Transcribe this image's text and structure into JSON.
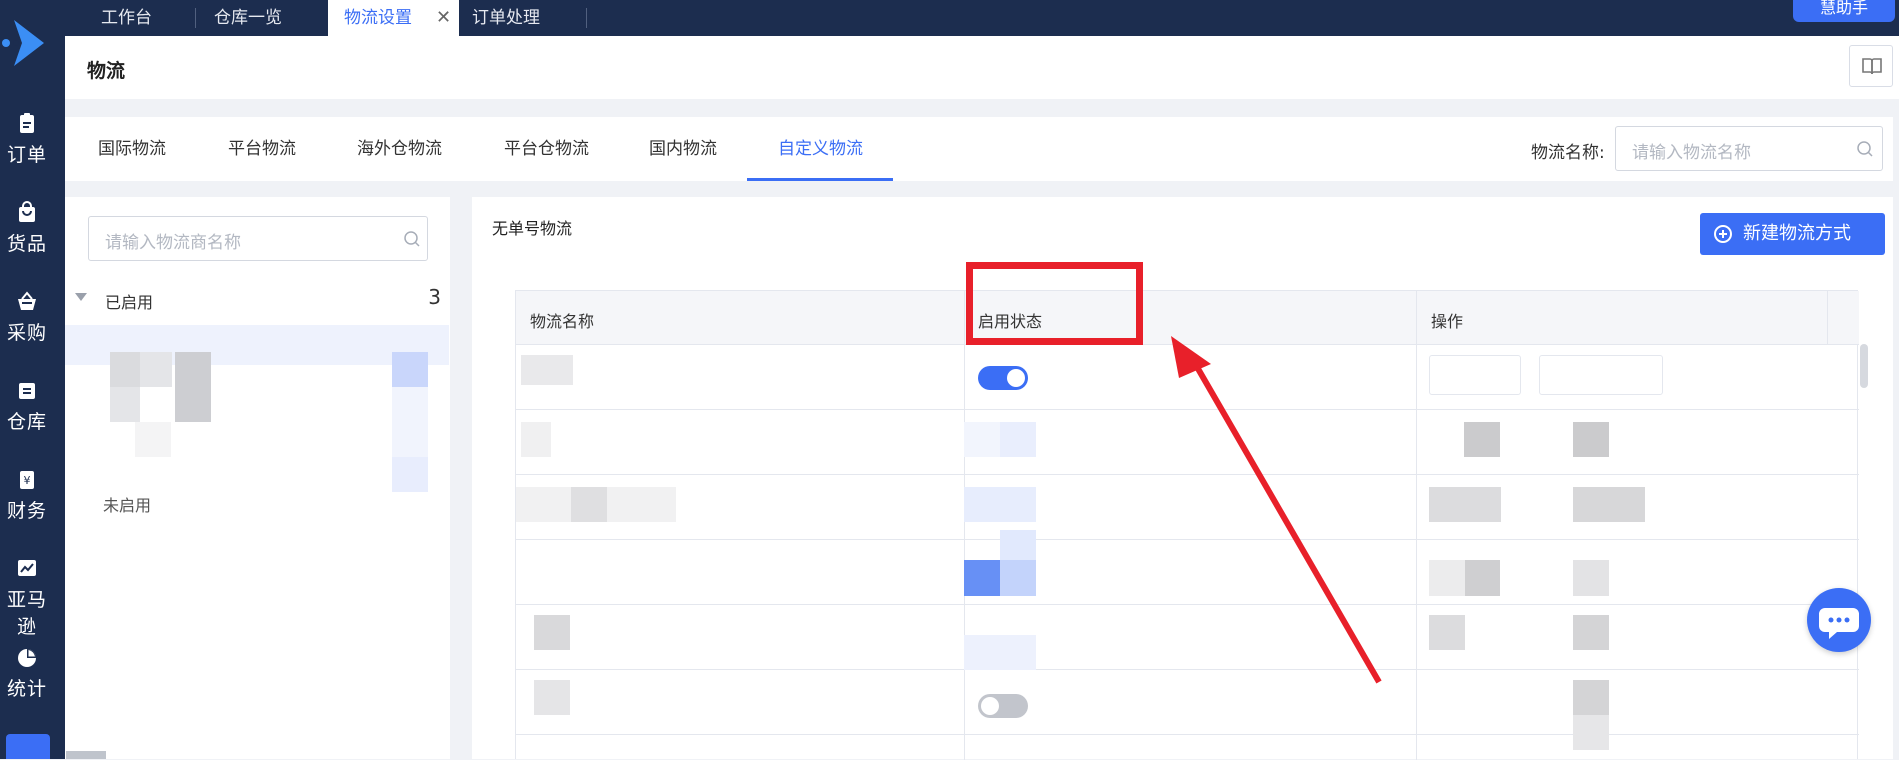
{
  "top_tabs": [
    {
      "label": "工作台",
      "active": false
    },
    {
      "label": "仓库一览",
      "active": false
    },
    {
      "label": "物流设置",
      "active": true,
      "closable": true
    },
    {
      "label": "订单处理",
      "active": false
    }
  ],
  "helper_button": "慧助手",
  "sidebar": {
    "items": [
      {
        "label": "订单",
        "icon": "clipboard-icon"
      },
      {
        "label": "货品",
        "icon": "bag-icon"
      },
      {
        "label": "采购",
        "icon": "basket-icon"
      },
      {
        "label": "仓库",
        "icon": "warehouse-icon"
      },
      {
        "label": "财务",
        "icon": "yen-icon"
      },
      {
        "label": "亚马逊",
        "icon": "trend-chart-icon"
      },
      {
        "label": "统计",
        "icon": "pie-chart-icon"
      }
    ]
  },
  "page_title": "物流",
  "sub_tabs": [
    {
      "label": "国际物流",
      "active": false
    },
    {
      "label": "平台物流",
      "active": false
    },
    {
      "label": "海外仓物流",
      "active": false
    },
    {
      "label": "平台仓物流",
      "active": false
    },
    {
      "label": "国内物流",
      "active": false
    },
    {
      "label": "自定义物流",
      "active": true
    }
  ],
  "filter": {
    "label": "物流名称:",
    "placeholder": "请输入物流名称"
  },
  "left_panel": {
    "search_placeholder": "请输入物流商名称",
    "enabled_group": {
      "label": "已启用",
      "count": "3"
    },
    "disabled_group": {
      "label": "未启用"
    }
  },
  "main": {
    "section_title": "无单号物流",
    "new_button": "新建物流方式",
    "table": {
      "columns": [
        "物流名称",
        "启用状态",
        "操作"
      ],
      "rows": [
        {
          "status": "on"
        },
        {
          "status": "hidden"
        },
        {
          "status": "hidden"
        },
        {
          "status": "hidden"
        },
        {
          "status": "hidden"
        },
        {
          "status": "off"
        }
      ]
    }
  },
  "colors": {
    "sidebar_bg": "#1c2d4f",
    "accent": "#3b6ef5",
    "annotation_red": "#e8202a"
  }
}
